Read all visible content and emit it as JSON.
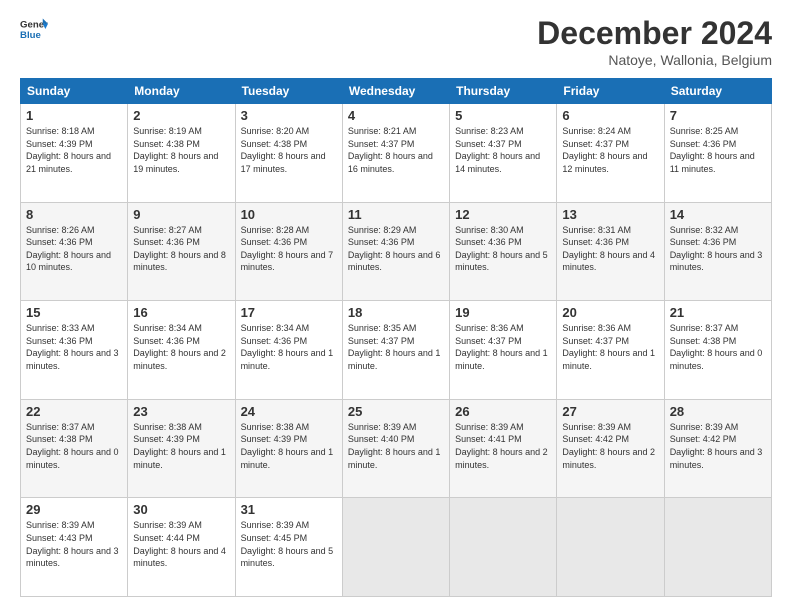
{
  "header": {
    "logo_line1": "General",
    "logo_line2": "Blue",
    "title": "December 2024",
    "subtitle": "Natoye, Wallonia, Belgium"
  },
  "calendar": {
    "columns": [
      "Sunday",
      "Monday",
      "Tuesday",
      "Wednesday",
      "Thursday",
      "Friday",
      "Saturday"
    ],
    "weeks": [
      [
        null,
        {
          "day": 2,
          "sunrise": "8:19 AM",
          "sunset": "4:38 PM",
          "daylight": "8 hours and 19 minutes."
        },
        {
          "day": 3,
          "sunrise": "8:20 AM",
          "sunset": "4:38 PM",
          "daylight": "8 hours and 17 minutes."
        },
        {
          "day": 4,
          "sunrise": "8:21 AM",
          "sunset": "4:37 PM",
          "daylight": "8 hours and 16 minutes."
        },
        {
          "day": 5,
          "sunrise": "8:23 AM",
          "sunset": "4:37 PM",
          "daylight": "8 hours and 14 minutes."
        },
        {
          "day": 6,
          "sunrise": "8:24 AM",
          "sunset": "4:37 PM",
          "daylight": "8 hours and 12 minutes."
        },
        {
          "day": 7,
          "sunrise": "8:25 AM",
          "sunset": "4:36 PM",
          "daylight": "8 hours and 11 minutes."
        }
      ],
      [
        {
          "day": 1,
          "sunrise": "8:18 AM",
          "sunset": "4:39 PM",
          "daylight": "8 hours and 21 minutes."
        },
        null,
        null,
        null,
        null,
        null,
        null
      ],
      [
        {
          "day": 8,
          "sunrise": "8:26 AM",
          "sunset": "4:36 PM",
          "daylight": "8 hours and 10 minutes."
        },
        {
          "day": 9,
          "sunrise": "8:27 AM",
          "sunset": "4:36 PM",
          "daylight": "8 hours and 8 minutes."
        },
        {
          "day": 10,
          "sunrise": "8:28 AM",
          "sunset": "4:36 PM",
          "daylight": "8 hours and 7 minutes."
        },
        {
          "day": 11,
          "sunrise": "8:29 AM",
          "sunset": "4:36 PM",
          "daylight": "8 hours and 6 minutes."
        },
        {
          "day": 12,
          "sunrise": "8:30 AM",
          "sunset": "4:36 PM",
          "daylight": "8 hours and 5 minutes."
        },
        {
          "day": 13,
          "sunrise": "8:31 AM",
          "sunset": "4:36 PM",
          "daylight": "8 hours and 4 minutes."
        },
        {
          "day": 14,
          "sunrise": "8:32 AM",
          "sunset": "4:36 PM",
          "daylight": "8 hours and 3 minutes."
        }
      ],
      [
        {
          "day": 15,
          "sunrise": "8:33 AM",
          "sunset": "4:36 PM",
          "daylight": "8 hours and 3 minutes."
        },
        {
          "day": 16,
          "sunrise": "8:34 AM",
          "sunset": "4:36 PM",
          "daylight": "8 hours and 2 minutes."
        },
        {
          "day": 17,
          "sunrise": "8:34 AM",
          "sunset": "4:36 PM",
          "daylight": "8 hours and 1 minute."
        },
        {
          "day": 18,
          "sunrise": "8:35 AM",
          "sunset": "4:37 PM",
          "daylight": "8 hours and 1 minute."
        },
        {
          "day": 19,
          "sunrise": "8:36 AM",
          "sunset": "4:37 PM",
          "daylight": "8 hours and 1 minute."
        },
        {
          "day": 20,
          "sunrise": "8:36 AM",
          "sunset": "4:37 PM",
          "daylight": "8 hours and 1 minute."
        },
        {
          "day": 21,
          "sunrise": "8:37 AM",
          "sunset": "4:38 PM",
          "daylight": "8 hours and 0 minutes."
        }
      ],
      [
        {
          "day": 22,
          "sunrise": "8:37 AM",
          "sunset": "4:38 PM",
          "daylight": "8 hours and 0 minutes."
        },
        {
          "day": 23,
          "sunrise": "8:38 AM",
          "sunset": "4:39 PM",
          "daylight": "8 hours and 1 minute."
        },
        {
          "day": 24,
          "sunrise": "8:38 AM",
          "sunset": "4:39 PM",
          "daylight": "8 hours and 1 minute."
        },
        {
          "day": 25,
          "sunrise": "8:39 AM",
          "sunset": "4:40 PM",
          "daylight": "8 hours and 1 minute."
        },
        {
          "day": 26,
          "sunrise": "8:39 AM",
          "sunset": "4:41 PM",
          "daylight": "8 hours and 2 minutes."
        },
        {
          "day": 27,
          "sunrise": "8:39 AM",
          "sunset": "4:42 PM",
          "daylight": "8 hours and 2 minutes."
        },
        {
          "day": 28,
          "sunrise": "8:39 AM",
          "sunset": "4:42 PM",
          "daylight": "8 hours and 3 minutes."
        }
      ],
      [
        {
          "day": 29,
          "sunrise": "8:39 AM",
          "sunset": "4:43 PM",
          "daylight": "8 hours and 3 minutes."
        },
        {
          "day": 30,
          "sunrise": "8:39 AM",
          "sunset": "4:44 PM",
          "daylight": "8 hours and 4 minutes."
        },
        {
          "day": 31,
          "sunrise": "8:39 AM",
          "sunset": "4:45 PM",
          "daylight": "8 hours and 5 minutes."
        },
        null,
        null,
        null,
        null
      ]
    ]
  }
}
